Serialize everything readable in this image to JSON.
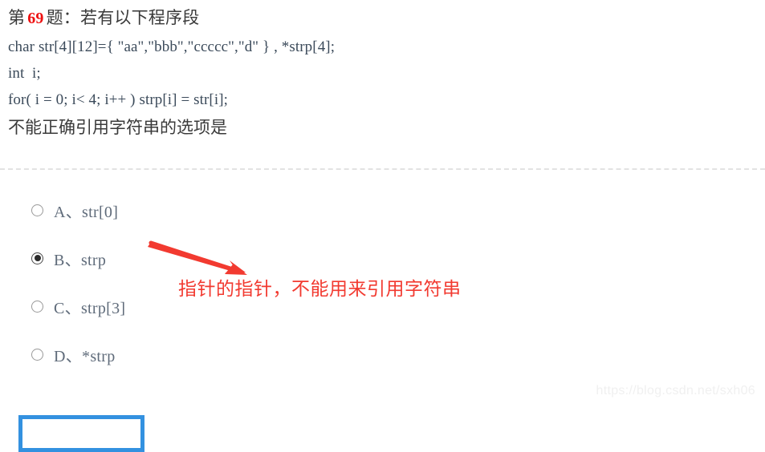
{
  "question": {
    "prefix": "第",
    "number": "69",
    "suffix": "题：若有以下程序段",
    "code_lines": [
      "char str[4][12]={ \"aa\",\"bbb\",\"ccccc\",\"d\" } , *strp[4];",
      "int  i;",
      "for( i = 0; i< 4; i++ ) strp[i] = str[i];"
    ],
    "tail": "不能正确引用字符串的选项是"
  },
  "options": [
    {
      "id": "A",
      "label": "A、str[0]",
      "selected": false
    },
    {
      "id": "B",
      "label": "B、strp",
      "selected": true
    },
    {
      "id": "C",
      "label": "C、strp[3]",
      "selected": false
    },
    {
      "id": "D",
      "label": "D、*strp",
      "selected": false
    }
  ],
  "annotation": {
    "text": "指针的指针，不能用来引用字符串",
    "color": "#f23a30"
  },
  "highlight": {
    "color": "#3391e0",
    "target_option": "B"
  },
  "watermark": {
    "text": "https://blog.csdn.net/sxh06"
  }
}
